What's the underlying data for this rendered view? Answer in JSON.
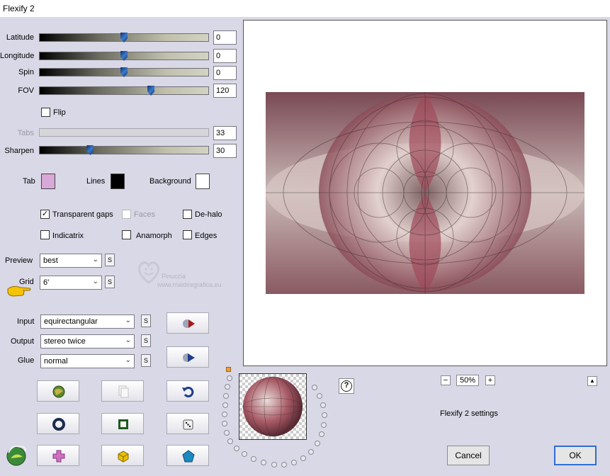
{
  "window": {
    "title": "Flexify 2"
  },
  "sliders": {
    "latitude": {
      "label": "Latitude",
      "value": "0",
      "level": 0.5
    },
    "longitude": {
      "label": "Longitude",
      "value": "0",
      "level": 0.5
    },
    "spin": {
      "label": "Spin",
      "value": "0",
      "level": 0.5
    },
    "fov": {
      "label": "FOV",
      "value": "120",
      "level": 0.66
    },
    "tabs": {
      "label": "Tabs",
      "value": "33",
      "disabled": true
    },
    "sharpen": {
      "label": "Sharpen",
      "value": "30",
      "level": 0.3
    }
  },
  "flip": {
    "label": "Flip",
    "checked": false
  },
  "colors": {
    "tab": {
      "label": "Tab",
      "color": "#d8a8d8"
    },
    "lines": {
      "label": "Lines",
      "color": "#000000"
    },
    "background": {
      "label": "Background",
      "color": "#ffffff"
    }
  },
  "options": {
    "transparent_gaps": {
      "label": "Transparent gaps",
      "checked": true
    },
    "faces": {
      "label": "Faces",
      "checked": false,
      "disabled": true
    },
    "de_halo": {
      "label": "De-halo",
      "checked": false
    },
    "indicatrix": {
      "label": "Indicatrix",
      "checked": false
    },
    "anamorph": {
      "label": "Anamorph",
      "checked": false
    },
    "edges": {
      "label": "Edges",
      "checked": false
    }
  },
  "preview": {
    "label": "Preview",
    "value": "best",
    "s": "S"
  },
  "grid": {
    "label": "Grid",
    "value": "6'",
    "s": "S"
  },
  "input": {
    "label": "Input",
    "value": "equirectangular",
    "s": "S"
  },
  "output": {
    "label": "Output",
    "value": "stereo twice",
    "s": "S"
  },
  "glue": {
    "label": "Glue",
    "value": "normal",
    "s": "S"
  },
  "watermark": {
    "line1": "Pinuccia",
    "line2": "www.maidiregrafica.eu"
  },
  "help": {
    "label": "?"
  },
  "zoom": {
    "minus": "−",
    "value": "50%",
    "plus": "+"
  },
  "collapse": {
    "label": "▲"
  },
  "settings_label": "Flexify 2 settings",
  "buttons": {
    "cancel": "Cancel",
    "ok": "OK"
  },
  "accent": "#2f6fd0"
}
